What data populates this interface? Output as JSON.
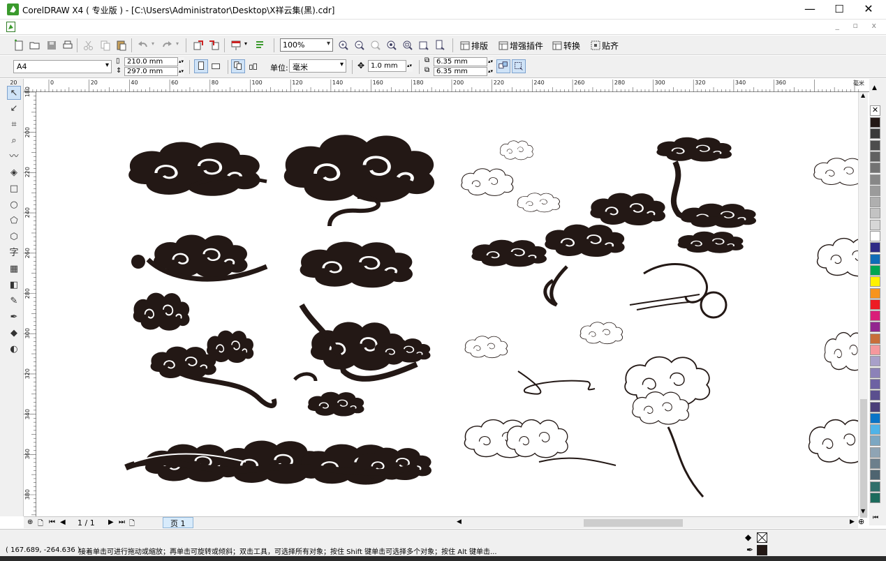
{
  "window": {
    "title": "CorelDRAW X4 ( 专业版 ) - [C:\\Users\\Administrator\\Desktop\\X祥云集(黑).cdr]",
    "minimize": "—",
    "maximize": "☐",
    "close": "✕"
  },
  "menubar": {
    "mdi_controls": "_ ▫ x"
  },
  "toolbar": {
    "zoom_value": "100%",
    "plugins": [
      {
        "label": "排版",
        "icon": "layout-icon"
      },
      {
        "label": "增强插件",
        "icon": "plugin-icon"
      },
      {
        "label": "转换",
        "icon": "convert-icon"
      },
      {
        "label": "贴齐",
        "icon": "snap-icon"
      }
    ]
  },
  "propertybar": {
    "paper_size": "A4",
    "width": "210.0 mm",
    "height": "297.0 mm",
    "units_label": "单位:",
    "units_value": "毫米",
    "nudge": "1.0 mm",
    "dup_x": "6.35 mm",
    "dup_y": "6.35 mm"
  },
  "toolbox": [
    "pick-tool-icon",
    "shape-tool-icon",
    "crop-tool-icon",
    "zoom-tool-icon",
    "freehand-tool-icon",
    "smart-fill-icon",
    "rectangle-tool-icon",
    "ellipse-tool-icon",
    "polygon-tool-icon",
    "basic-shapes-icon",
    "text-tool-icon",
    "table-tool-icon",
    "interactive-blend-icon",
    "eyedropper-icon",
    "outline-pen-icon",
    "fill-tool-icon",
    "interactive-fill-icon"
  ],
  "toolbox_text_glyph": "字",
  "ruler": {
    "unit": "毫米",
    "h_labels": [
      "20",
      "0",
      "20",
      "40",
      "60",
      "80",
      "100",
      "120",
      "140",
      "160",
      "180",
      "200",
      "220",
      "240",
      "260",
      "280",
      "300",
      "320",
      "340",
      "360"
    ],
    "v_labels": [
      "180",
      "200",
      "220",
      "240",
      "260",
      "280",
      "300",
      "320",
      "340",
      "360",
      "380"
    ]
  },
  "palette_colors": [
    "#231815",
    "#3a3a3a",
    "#4d4d4d",
    "#606060",
    "#737373",
    "#878787",
    "#9b9b9b",
    "#afafaf",
    "#c3c3c3",
    "#d7d7d7",
    "#ffffff",
    "#2e2a86",
    "#0f6cb7",
    "#00a651",
    "#fff200",
    "#f7941d",
    "#ed1c24",
    "#d91e79",
    "#92278f",
    "#c86e3a",
    "#f5989d",
    "#a8a0c9",
    "#8c82b8",
    "#6d62a3",
    "#5a4f8e",
    "#4b3f78",
    "#0b74c7",
    "#4fb3e8",
    "#7ca7c2",
    "#8fa4b4",
    "#6c7f8c",
    "#4e6470",
    "#2f6f6a",
    "#1c6b5c"
  ],
  "pagenav": {
    "counter": "1 / 1",
    "page_tab": "页 1"
  },
  "status": {
    "coords": "( 167.689, -264.636 )",
    "hint": "接着单击可进行拖动或缩放；再单击可旋转或倾斜；双击工具，可选择所有对象；按住 Shift 键单击可选择多个对象；按住 Alt 键单击..."
  }
}
